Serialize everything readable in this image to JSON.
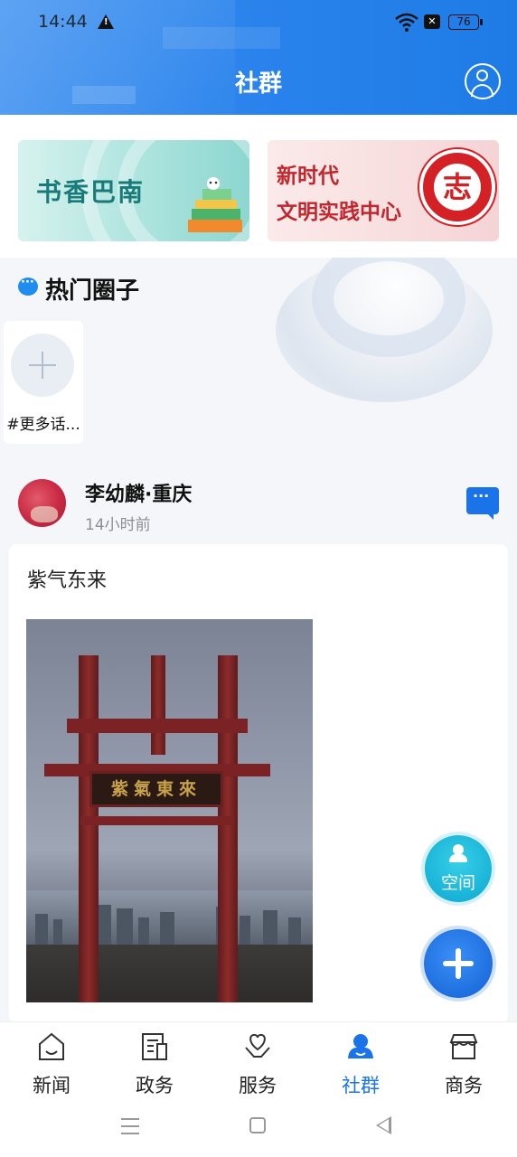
{
  "status_bar": {
    "time": "14:44",
    "battery": "76",
    "notification_icons": [
      "warning-icon",
      "wifi-icon",
      "sim-off-icon"
    ]
  },
  "header": {
    "title": "社群",
    "user_icon": "user-icon"
  },
  "banners": [
    {
      "label": "书香巴南",
      "icon": "books-icon"
    },
    {
      "label_line1": "新时代",
      "label_line2": "文明实践中心",
      "seal_char": "志",
      "icon": "volunteer-seal-icon"
    }
  ],
  "hot_circles": {
    "title": "热门圈子",
    "icon": "chat-bubble-icon",
    "more_label": "#更多话..."
  },
  "post": {
    "author": "李幼麟·重庆",
    "time_ago": "14小时前",
    "text": "紫气东来",
    "photo_plaque": "紫氣東來",
    "message_icon": "message-icon"
  },
  "fab": {
    "space_label": "空间",
    "add_icon": "plus-icon"
  },
  "bottom_nav": [
    {
      "label": "新闻",
      "icon": "news-icon",
      "active": false
    },
    {
      "label": "政务",
      "icon": "document-icon",
      "active": false
    },
    {
      "label": "服务",
      "icon": "heart-hand-icon",
      "active": false
    },
    {
      "label": "社群",
      "icon": "community-icon",
      "active": true
    },
    {
      "label": "商务",
      "icon": "store-icon",
      "active": false
    }
  ],
  "colors": {
    "header_blue": "#2a83ec",
    "active_blue": "#1a73e8",
    "seal_red": "#d32126",
    "teal_text": "#197a7a"
  }
}
